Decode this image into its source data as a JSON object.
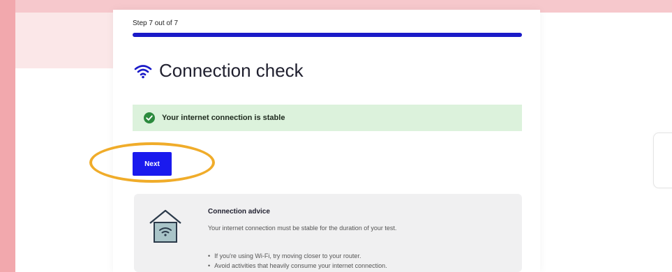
{
  "step": {
    "label": "Step 7 out of 7",
    "progress_fraction": 1.0
  },
  "header": {
    "title": "Connection check",
    "icon": "wifi-icon"
  },
  "status": {
    "message": "Your internet connection is stable",
    "icon": "check-circle-icon",
    "color": "#dcf2dc"
  },
  "actions": {
    "next_label": "Next",
    "accent_color": "#1a1aee",
    "highlight_color": "#f0ac2a"
  },
  "advice": {
    "title": "Connection advice",
    "body": "Your internet connection must be stable for the duration of your test.",
    "tips": [
      "If you're using Wi-Fi, try moving closer to your router.",
      "Avoid activities that heavily consume your internet connection."
    ],
    "icon": "house-wifi-icon"
  }
}
